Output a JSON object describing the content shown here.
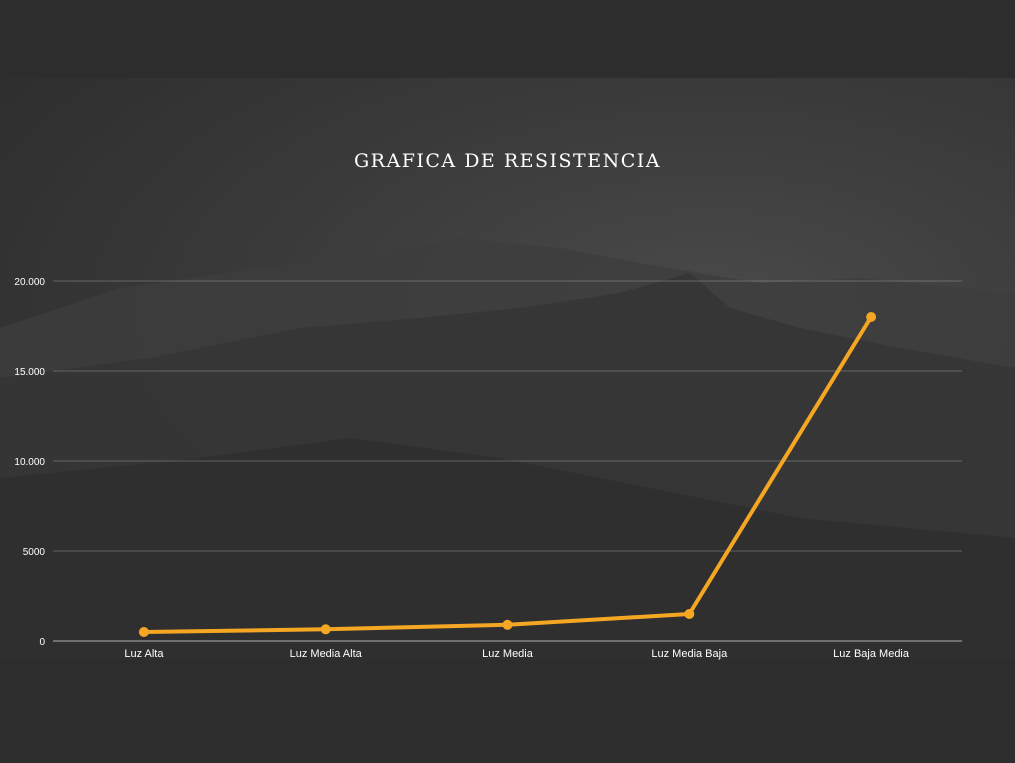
{
  "colors": {
    "background": "#2d2d2d",
    "line": "#f5a623",
    "grid": "#bdbdbd",
    "text": "#ffffff"
  },
  "chart_data": {
    "type": "line",
    "title": "GRAFICA DE RESISTENCIA",
    "xlabel": "",
    "ylabel": "",
    "categories": [
      "Luz Alta",
      "Luz Media Alta",
      "Luz Media",
      "Luz Media Baja",
      "Luz Baja Media"
    ],
    "series": [
      {
        "values": [
          500,
          650,
          900,
          1500,
          18000
        ]
      }
    ],
    "ylim": [
      0,
      20000
    ],
    "yticks": [
      0,
      5000,
      10000,
      15000,
      20000
    ],
    "ytick_labels": [
      "0",
      "5000",
      "10.000",
      "15.000",
      "20.000"
    ],
    "grid": true,
    "legend": "none"
  }
}
